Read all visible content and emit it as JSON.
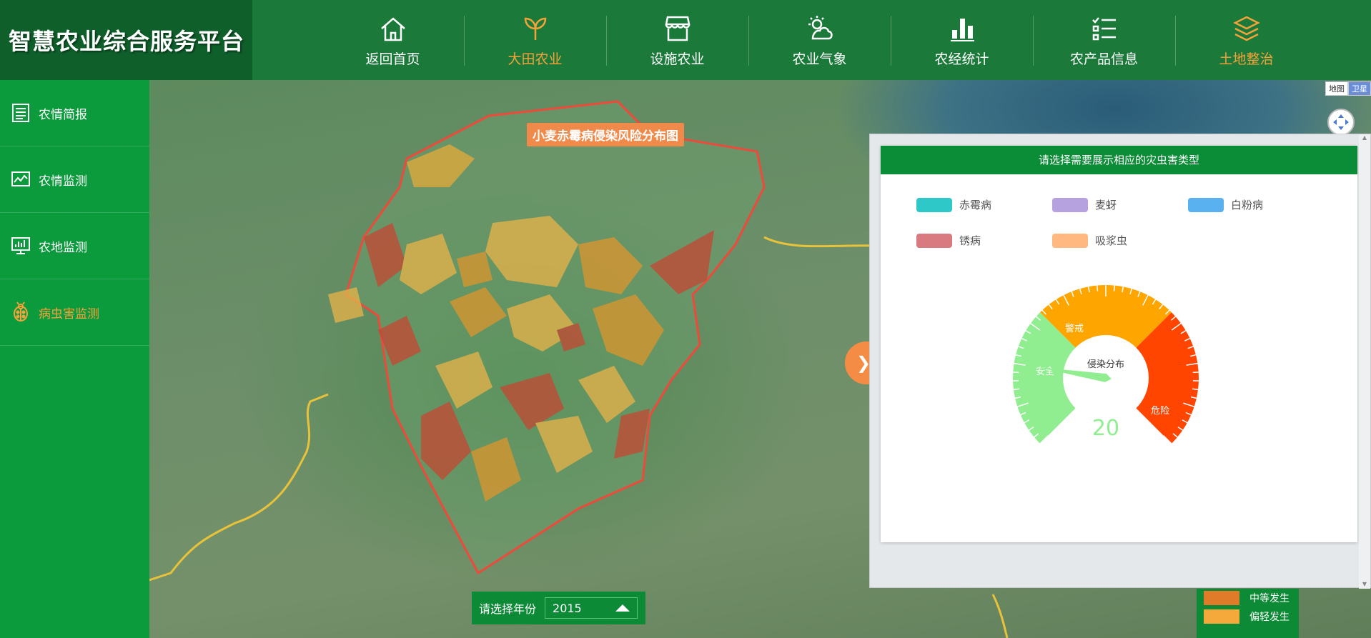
{
  "app": {
    "title": "智慧农业综合服务平台"
  },
  "nav": [
    {
      "label": "返回首页",
      "icon": "home-icon",
      "active": false
    },
    {
      "label": "大田农业",
      "icon": "sprout-icon",
      "active": true
    },
    {
      "label": "设施农业",
      "icon": "greenhouse-icon",
      "active": false
    },
    {
      "label": "农业气象",
      "icon": "weather-icon",
      "active": false
    },
    {
      "label": "农经统计",
      "icon": "bar-chart-icon",
      "active": false
    },
    {
      "label": "农产品信息",
      "icon": "checklist-icon",
      "active": false
    },
    {
      "label": "土地整治",
      "icon": "layers-icon",
      "active": true
    }
  ],
  "sidebar": [
    {
      "label": "农情简报",
      "icon": "report-icon",
      "active": false
    },
    {
      "label": "农情监测",
      "icon": "line-chart-icon",
      "active": false
    },
    {
      "label": "农地监测",
      "icon": "monitor-icon",
      "active": false
    },
    {
      "label": "病虫害监测",
      "icon": "ladybug-icon",
      "active": true
    }
  ],
  "map": {
    "title": "小麦赤霉病侵染风险分布图",
    "type_map": "地图",
    "type_satellite": "卫星",
    "collapse_glyph": "❯"
  },
  "panel": {
    "header": "请选择需要展示相应的灾虫害类型",
    "legend": [
      {
        "label": "赤霉病",
        "color": "#2ec8c8"
      },
      {
        "label": "麦蚜",
        "color": "#b6a2de"
      },
      {
        "label": "白粉病",
        "color": "#5ab1ef"
      },
      {
        "label": "锈病",
        "color": "#d87a80"
      },
      {
        "label": "吸浆虫",
        "color": "#ffb980"
      }
    ],
    "gauge": {
      "title": "侵染分布",
      "value": 20,
      "bands": [
        {
          "label": "安全",
          "color": "#90ee90"
        },
        {
          "label": "警戒",
          "color": "#ffa500"
        },
        {
          "label": "危险",
          "color": "#ff4500"
        }
      ]
    }
  },
  "year": {
    "label": "请选择年份",
    "value": "2015"
  },
  "map_legend": [
    {
      "label": "中等发生",
      "color": "#e07b2a"
    },
    {
      "label": "偏轻发生",
      "color": "#f4a93a"
    }
  ]
}
